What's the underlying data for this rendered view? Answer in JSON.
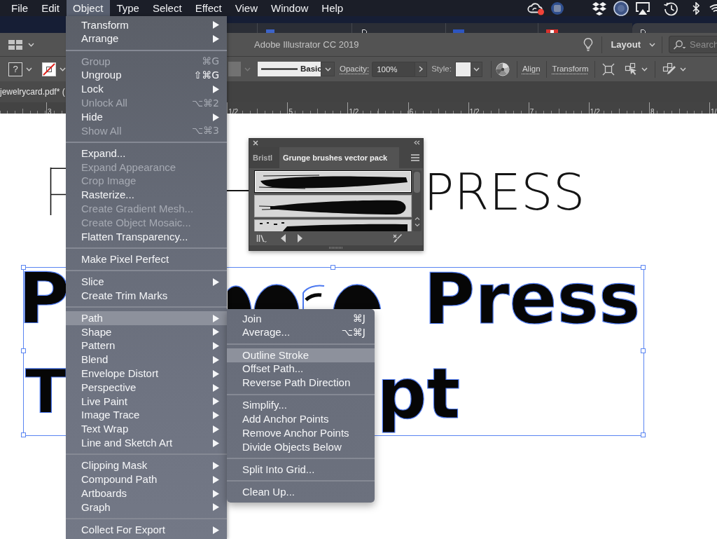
{
  "menu_bar": {
    "items": [
      {
        "label": "File",
        "selected": false
      },
      {
        "label": "Edit",
        "selected": false
      },
      {
        "label": "Object",
        "selected": true
      },
      {
        "label": "Type",
        "selected": false
      },
      {
        "label": "Select",
        "selected": false
      },
      {
        "label": "Effect",
        "selected": false
      },
      {
        "label": "View",
        "selected": false
      },
      {
        "label": "Window",
        "selected": false
      },
      {
        "label": "Help",
        "selected": false
      }
    ]
  },
  "title_bar": {
    "title": "Adobe Illustrator CC 2019",
    "workspace": "Layout",
    "search": {
      "placeholder": "Search"
    }
  },
  "control_bar": {
    "fill_swatch": "?",
    "stroke_profile": "Basic",
    "opacity_label": "Opacity:",
    "opacity": "100%",
    "style_label": "Style:",
    "links": [
      "Align",
      "Transform"
    ]
  },
  "document_tab": {
    "title": "jewelrycard.pdf* ("
  },
  "ruler": {
    "labels": [
      "3",
      "1/2",
      "5",
      "1/2",
      "6",
      "1/2",
      "7",
      "1/2",
      "8",
      "1/"
    ]
  },
  "canvas": {
    "heading": "PRESS",
    "brush_lines": [
      {
        "left": "P",
        "right": "Press"
      },
      {
        "left": "T",
        "right": "pt"
      }
    ]
  },
  "brushes_panel": {
    "tabs": [
      {
        "label": "Bristl",
        "selected": false
      },
      {
        "label": "Grunge brushes vector pack",
        "selected": true
      }
    ],
    "brushes": [
      {
        "selected": true
      },
      {
        "selected": false
      },
      {
        "selected": false
      }
    ]
  },
  "object_menu": {
    "sections": [
      [
        {
          "label": "Transform",
          "submenu": true,
          "disabled": false,
          "selected": false
        },
        {
          "label": "Arrange",
          "submenu": true,
          "disabled": false,
          "selected": false
        }
      ],
      [
        {
          "label": "Group",
          "shortcut": "⌘G",
          "submenu": false,
          "disabled": true,
          "selected": false
        },
        {
          "label": "Ungroup",
          "shortcut": "⇧⌘G",
          "submenu": false,
          "disabled": false,
          "selected": false
        },
        {
          "label": "Lock",
          "submenu": true,
          "disabled": false,
          "selected": false
        },
        {
          "label": "Unlock All",
          "shortcut": "⌥⌘2",
          "submenu": false,
          "disabled": true,
          "selected": false
        },
        {
          "label": "Hide",
          "submenu": true,
          "disabled": false,
          "selected": false
        },
        {
          "label": "Show All",
          "shortcut": "⌥⌘3",
          "submenu": false,
          "disabled": true,
          "selected": false
        }
      ],
      [
        {
          "label": "Expand...",
          "submenu": false,
          "disabled": false,
          "selected": false
        },
        {
          "label": "Expand Appearance",
          "submenu": false,
          "disabled": true,
          "selected": false
        },
        {
          "label": "Crop Image",
          "submenu": false,
          "disabled": true,
          "selected": false
        },
        {
          "label": "Rasterize...",
          "submenu": false,
          "disabled": false,
          "selected": false
        },
        {
          "label": "Create Gradient Mesh...",
          "submenu": false,
          "disabled": true,
          "selected": false
        },
        {
          "label": "Create Object Mosaic...",
          "submenu": false,
          "disabled": true,
          "selected": false
        },
        {
          "label": "Flatten Transparency...",
          "submenu": false,
          "disabled": false,
          "selected": false
        }
      ],
      [
        {
          "label": "Make Pixel Perfect",
          "submenu": false,
          "disabled": false,
          "selected": false
        }
      ],
      [
        {
          "label": "Slice",
          "submenu": true,
          "disabled": false,
          "selected": false
        },
        {
          "label": "Create Trim Marks",
          "submenu": false,
          "disabled": false,
          "selected": false
        }
      ],
      [
        {
          "label": "Path",
          "submenu": true,
          "disabled": false,
          "selected": true
        },
        {
          "label": "Shape",
          "submenu": true,
          "disabled": false,
          "selected": false
        },
        {
          "label": "Pattern",
          "submenu": true,
          "disabled": false,
          "selected": false
        },
        {
          "label": "Blend",
          "submenu": true,
          "disabled": false,
          "selected": false
        },
        {
          "label": "Envelope Distort",
          "submenu": true,
          "disabled": false,
          "selected": false
        },
        {
          "label": "Perspective",
          "submenu": true,
          "disabled": false,
          "selected": false
        },
        {
          "label": "Live Paint",
          "submenu": true,
          "disabled": false,
          "selected": false
        },
        {
          "label": "Image Trace",
          "submenu": true,
          "disabled": false,
          "selected": false
        },
        {
          "label": "Text Wrap",
          "submenu": true,
          "disabled": false,
          "selected": false
        },
        {
          "label": "Line and Sketch Art",
          "submenu": true,
          "disabled": false,
          "selected": false
        }
      ],
      [
        {
          "label": "Clipping Mask",
          "submenu": true,
          "disabled": false,
          "selected": false
        },
        {
          "label": "Compound Path",
          "submenu": true,
          "disabled": false,
          "selected": false
        },
        {
          "label": "Artboards",
          "submenu": true,
          "disabled": false,
          "selected": false
        },
        {
          "label": "Graph",
          "submenu": true,
          "disabled": false,
          "selected": false
        }
      ],
      [
        {
          "label": "Collect For Export",
          "submenu": true,
          "disabled": false,
          "selected": false
        }
      ]
    ]
  },
  "path_submenu": {
    "sections": [
      [
        {
          "label": "Join",
          "shortcut": "⌘J",
          "selected": false
        },
        {
          "label": "Average...",
          "shortcut": "⌥⌘J",
          "selected": false
        }
      ],
      [
        {
          "label": "Outline Stroke",
          "selected": true
        },
        {
          "label": "Offset Path...",
          "selected": false
        },
        {
          "label": "Reverse Path Direction",
          "selected": false
        }
      ],
      [
        {
          "label": "Simplify...",
          "selected": false
        },
        {
          "label": "Add Anchor Points",
          "selected": false
        },
        {
          "label": "Remove Anchor Points",
          "selected": false
        },
        {
          "label": "Divide Objects Below",
          "selected": false
        }
      ],
      [
        {
          "label": "Split Into Grid...",
          "selected": false
        }
      ],
      [
        {
          "label": "Clean Up...",
          "selected": false
        }
      ]
    ]
  }
}
